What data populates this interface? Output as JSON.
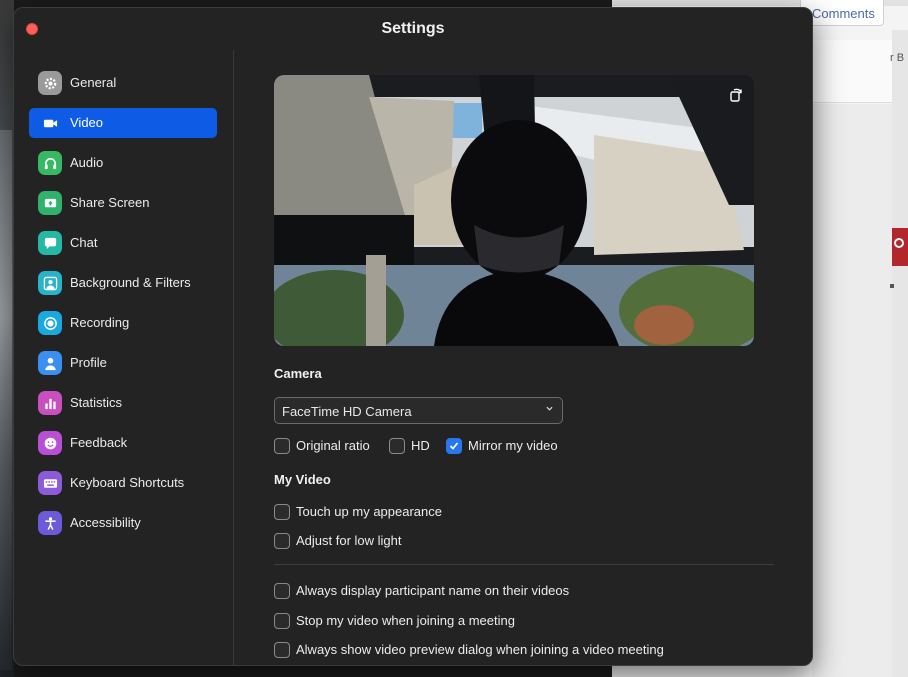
{
  "background": {
    "comments_label": "Comments",
    "side_text": "r B"
  },
  "window": {
    "title": "Settings"
  },
  "sidebar": {
    "items": [
      {
        "label": "General",
        "icon": "gear-icon",
        "color": "#9a9a9a"
      },
      {
        "label": "Video",
        "icon": "video-camera-icon",
        "color": "#0e5ce6"
      },
      {
        "label": "Audio",
        "icon": "headphones-icon",
        "color": "#37b862"
      },
      {
        "label": "Share Screen",
        "icon": "share-screen-icon",
        "color": "#2fb36b"
      },
      {
        "label": "Chat",
        "icon": "chat-bubble-icon",
        "color": "#25b8a5"
      },
      {
        "label": "Background & Filters",
        "icon": "person-background-icon",
        "color": "#27b4c9"
      },
      {
        "label": "Recording",
        "icon": "record-icon",
        "color": "#1aa9de"
      },
      {
        "label": "Profile",
        "icon": "person-icon",
        "color": "#3a8ff0"
      },
      {
        "label": "Statistics",
        "icon": "bar-chart-icon",
        "color": "#c94fc0"
      },
      {
        "label": "Feedback",
        "icon": "smiley-icon",
        "color": "#b84fd4"
      },
      {
        "label": "Keyboard Shortcuts",
        "icon": "keyboard-icon",
        "color": "#8c5bd9"
      },
      {
        "label": "Accessibility",
        "icon": "accessibility-icon",
        "color": "#6d5ad9"
      }
    ],
    "active_index": 1
  },
  "video": {
    "camera_title": "Camera",
    "camera_select": "FaceTime HD Camera",
    "camera_options": [
      {
        "label": "Original ratio",
        "checked": false
      },
      {
        "label": "HD",
        "checked": false
      },
      {
        "label": "Mirror my video",
        "checked": true
      }
    ],
    "my_video_title": "My Video",
    "my_video_options": [
      {
        "label": "Touch up my appearance",
        "checked": false
      },
      {
        "label": "Adjust for low light",
        "checked": false
      }
    ],
    "general_options": [
      {
        "label": "Always display participant name on their videos",
        "checked": false
      },
      {
        "label": "Stop my video when joining a meeting",
        "checked": false
      },
      {
        "label": "Always show video preview dialog when joining a video meeting",
        "checked": false
      }
    ]
  },
  "colors": {
    "accent": "#0e5ce6",
    "checkbox_checked": "#2877f0",
    "close_button": "#fe5f57"
  }
}
